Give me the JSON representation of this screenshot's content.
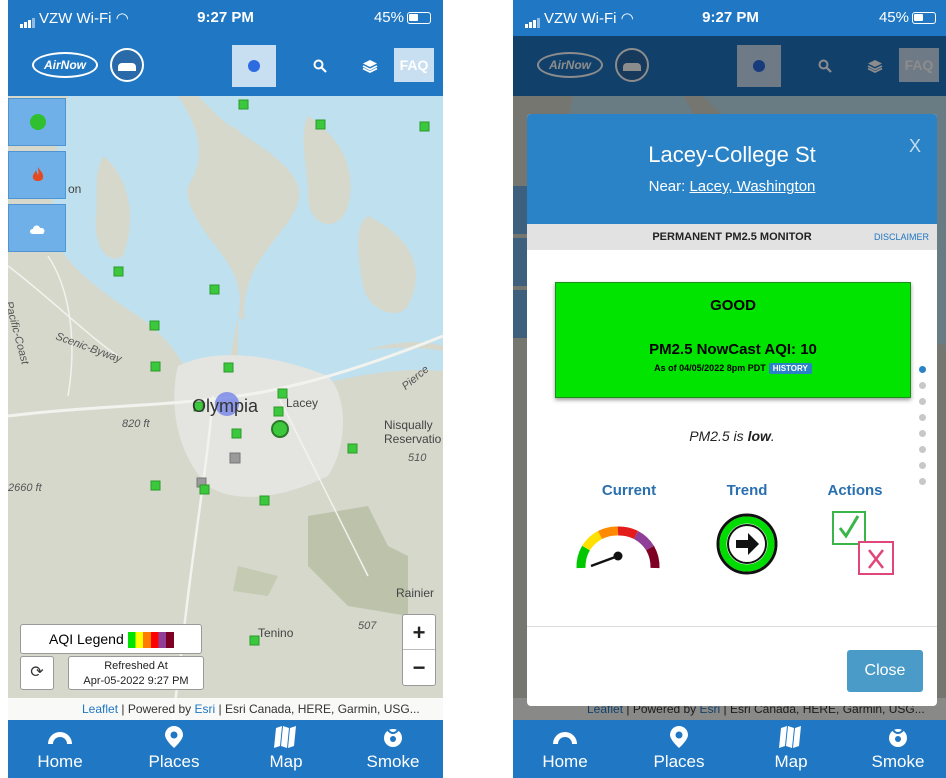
{
  "status_bar": {
    "carrier": "VZW Wi-Fi",
    "time": "9:27 PM",
    "battery": "45%"
  },
  "header": {
    "faq_label": "FAQ",
    "logo_text": "AirNow"
  },
  "map": {
    "place_labels": {
      "olympia": "Olympia",
      "lacey": "Lacey",
      "nisqually": "Nisqually",
      "reservation": "Reservatio",
      "elev_820": "820 ft",
      "elev_2660": "2660 ft",
      "rainier": "Rainier",
      "tenino": "Tenino",
      "scenic": "Scenic-Byway",
      "pierce": "Pierce",
      "on_fragment": "on",
      "route_510": "510",
      "route_507": "507",
      "pcoast": "Pacific-Coast"
    },
    "legend_label": "AQI Legend",
    "refreshed_label": "Refreshed At",
    "refreshed_time": "Apr-05-2022 9:27 PM",
    "zoom_in": "+",
    "zoom_out": "−",
    "attribution": {
      "leaflet": "Leaflet",
      "sep1": " | Powered by ",
      "esri": "Esri",
      "rest": " | Esri Canada, HERE, Garmin, USG..."
    },
    "aqi_colors": [
      "#00e400",
      "#ffff00",
      "#ff7e00",
      "#ff0000",
      "#8f3f97",
      "#7e0023"
    ]
  },
  "tabs": [
    {
      "label": "Home",
      "icon": "home-gauge-icon"
    },
    {
      "label": "Places",
      "icon": "map-pin-icon"
    },
    {
      "label": "Map",
      "icon": "map-icon"
    },
    {
      "label": "Smoke",
      "icon": "smoke-icon"
    }
  ],
  "modal": {
    "title": "Lacey-College St",
    "near_prefix": "Near: ",
    "near_place": "Lacey, Washington",
    "close_x": "X",
    "monitor_type": "PERMANENT PM2.5 MONITOR",
    "disclaimer": "DISCLAIMER",
    "category": "GOOD",
    "aqi_line": "PM2.5 NowCast AQI: 10",
    "as_of": "As of 04/05/2022 8pm PDT",
    "history_label": "HISTORY",
    "pm_msg_prefix": "PM2.5 is ",
    "pm_msg_level": "low",
    "pm_msg_suffix": ".",
    "sections": {
      "current": "Current",
      "trend": "Trend",
      "actions": "Actions"
    },
    "close_label": "Close",
    "category_color": "#00e400",
    "pager_active": 0,
    "pager_count": 8
  }
}
